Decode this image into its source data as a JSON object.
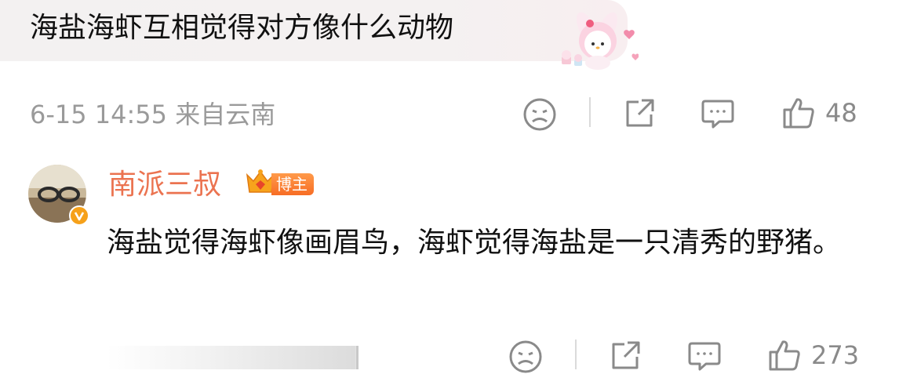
{
  "parent_comment": {
    "text": "海盐海虾互相觉得对方像什么动物",
    "meta": "6-15 14:55 来自云南",
    "like_count": "48"
  },
  "reply": {
    "username": "南派三叔",
    "badge_label": "博主",
    "text": "海盐觉得海虾像画眉鸟，海虾觉得海盐是一只清秀的野猪。",
    "like_count": "273"
  },
  "icons": {
    "dislike": "frown-face-icon",
    "share": "share-icon",
    "comment": "comment-icon",
    "like": "thumbs-up-icon",
    "verified": "verified-v-icon",
    "crown": "crown-icon",
    "sticker": "bunny-sticker-icon"
  },
  "colors": {
    "username": "#eb7350",
    "meta_text": "#9a9a9a",
    "icon": "#8a8a8a",
    "badge": "#f76d25"
  }
}
